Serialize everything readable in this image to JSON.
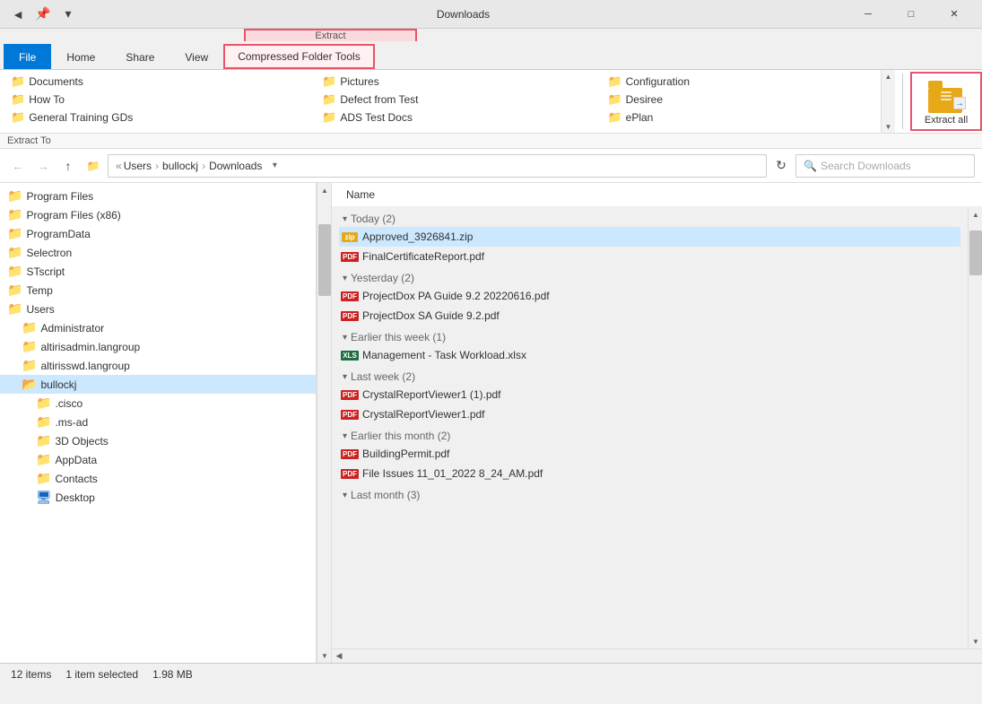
{
  "window": {
    "title": "Downloads",
    "title_full": "Downloads"
  },
  "titlebar": {
    "back_label": "←",
    "forward_label": "→",
    "dropdown_label": "▾",
    "minimize_label": "─",
    "maximize_label": "□",
    "close_label": "✕"
  },
  "ribbon": {
    "extract_label": "Extract",
    "compressed_folder_tools_label": "Compressed Folder Tools",
    "extract_to_label": "Extract To",
    "extract_all_label": "Extract all",
    "tabs": [
      {
        "id": "file",
        "label": "File"
      },
      {
        "id": "home",
        "label": "Home"
      },
      {
        "id": "share",
        "label": "Share"
      },
      {
        "id": "view",
        "label": "View"
      },
      {
        "id": "compressed",
        "label": "Compressed Folder Tools"
      }
    ],
    "favorites": [
      {
        "id": "documents",
        "label": "Documents",
        "type": "folder"
      },
      {
        "id": "howto",
        "label": "How To",
        "type": "folder"
      },
      {
        "id": "general-training",
        "label": "General Training GDs",
        "type": "folder"
      },
      {
        "id": "pictures",
        "label": "Pictures",
        "type": "folder"
      },
      {
        "id": "defect-from-test",
        "label": "Defect from Test",
        "type": "folder"
      },
      {
        "id": "ads-test-docs",
        "label": "ADS Test Docs",
        "type": "folder"
      },
      {
        "id": "configuration",
        "label": "Configuration",
        "type": "folder"
      },
      {
        "id": "desiree",
        "label": "Desiree",
        "type": "folder"
      },
      {
        "id": "eplan",
        "label": "ePlan",
        "type": "folder"
      }
    ]
  },
  "navbar": {
    "back_label": "←",
    "forward_label": "→",
    "up_label": "↑",
    "path": "« Users › bullockj › Downloads",
    "path_parts": [
      "Users",
      "bullockj",
      "Downloads"
    ],
    "search_placeholder": "Search Downloads",
    "refresh_label": "↻"
  },
  "nav_tree": {
    "items": [
      {
        "label": "Program Files",
        "indent": 0,
        "icon": "folder"
      },
      {
        "label": "Program Files (x86)",
        "indent": 0,
        "icon": "folder"
      },
      {
        "label": "ProgramData",
        "indent": 0,
        "icon": "folder"
      },
      {
        "label": "Selectron",
        "indent": 0,
        "icon": "folder"
      },
      {
        "label": "STscript",
        "indent": 0,
        "icon": "folder"
      },
      {
        "label": "Temp",
        "indent": 0,
        "icon": "folder"
      },
      {
        "label": "Users",
        "indent": 0,
        "icon": "folder"
      },
      {
        "label": "Administrator",
        "indent": 1,
        "icon": "folder"
      },
      {
        "label": "altirisadmin.langroup",
        "indent": 1,
        "icon": "folder"
      },
      {
        "label": "altirisswd.langroup",
        "indent": 1,
        "icon": "folder"
      },
      {
        "label": "bullockj",
        "indent": 1,
        "icon": "folder",
        "selected": true
      },
      {
        "label": ".cisco",
        "indent": 2,
        "icon": "folder-plain"
      },
      {
        "label": ".ms-ad",
        "indent": 2,
        "icon": "folder-plain"
      },
      {
        "label": "3D Objects",
        "indent": 2,
        "icon": "folder-special"
      },
      {
        "label": "AppData",
        "indent": 2,
        "icon": "folder-plain"
      },
      {
        "label": "Contacts",
        "indent": 2,
        "icon": "folder-contacts"
      },
      {
        "label": "Desktop",
        "indent": 2,
        "icon": "folder-desktop"
      }
    ]
  },
  "file_list": {
    "col_name": "Name",
    "groups": [
      {
        "label": "Today (2)",
        "files": [
          {
            "name": "Approved_3926841.zip",
            "type": "zip",
            "selected": true
          },
          {
            "name": "FinalCertificateReport.pdf",
            "type": "pdf"
          }
        ]
      },
      {
        "label": "Yesterday (2)",
        "files": [
          {
            "name": "ProjectDox PA Guide 9.2 20220616.pdf",
            "type": "pdf"
          },
          {
            "name": "ProjectDox SA Guide 9.2.pdf",
            "type": "pdf"
          }
        ]
      },
      {
        "label": "Earlier this week (1)",
        "files": [
          {
            "name": "Management - Task Workload.xlsx",
            "type": "xlsx"
          }
        ]
      },
      {
        "label": "Last week (2)",
        "files": [
          {
            "name": "CrystalReportViewer1 (1).pdf",
            "type": "pdf"
          },
          {
            "name": "CrystalReportViewer1.pdf",
            "type": "pdf"
          }
        ]
      },
      {
        "label": "Earlier this month (2)",
        "files": [
          {
            "name": "BuildingPermit.pdf",
            "type": "pdf"
          },
          {
            "name": "File Issues 11_01_2022 8_24_AM.pdf",
            "type": "pdf"
          }
        ]
      },
      {
        "label": "Last month (3)",
        "files": []
      }
    ]
  },
  "status_bar": {
    "item_count": "12 items",
    "selected_info": "1 item selected",
    "file_size": "1.98 MB"
  }
}
